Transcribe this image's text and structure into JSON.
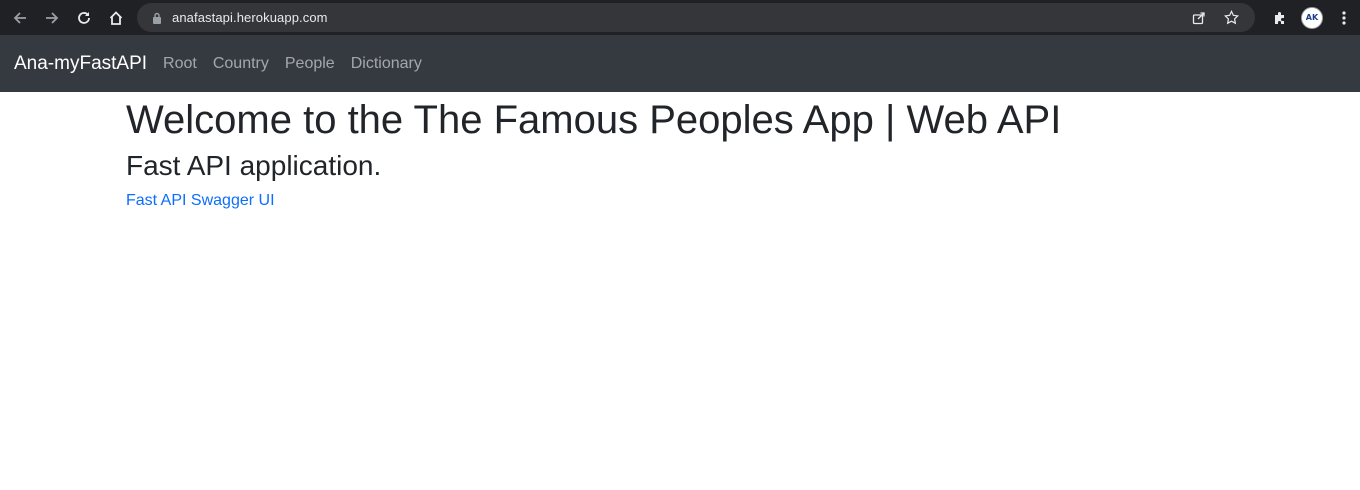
{
  "browser": {
    "url": "anafastapi.herokuapp.com",
    "profile_initials": "AK",
    "icons": [
      "back-arrow-icon",
      "forward-arrow-icon",
      "reload-icon",
      "home-icon",
      "lock-icon",
      "share-icon",
      "star-icon",
      "extensions-puzzle-icon",
      "avatar",
      "kebab-menu-icon"
    ]
  },
  "navbar": {
    "brand": "Ana-myFastAPI",
    "links": [
      "Root",
      "Country",
      "People",
      "Dictionary"
    ]
  },
  "main": {
    "title": "Welcome to the The Famous Peoples App | Web API",
    "subtitle": "Fast API application.",
    "link_text": "Fast API Swagger UI"
  },
  "colors": {
    "chrome_bg": "#202124",
    "omnibox_bg": "#35363a",
    "navbar_bg": "#343a40",
    "link": "#0d6efd",
    "heading": "#212529"
  }
}
